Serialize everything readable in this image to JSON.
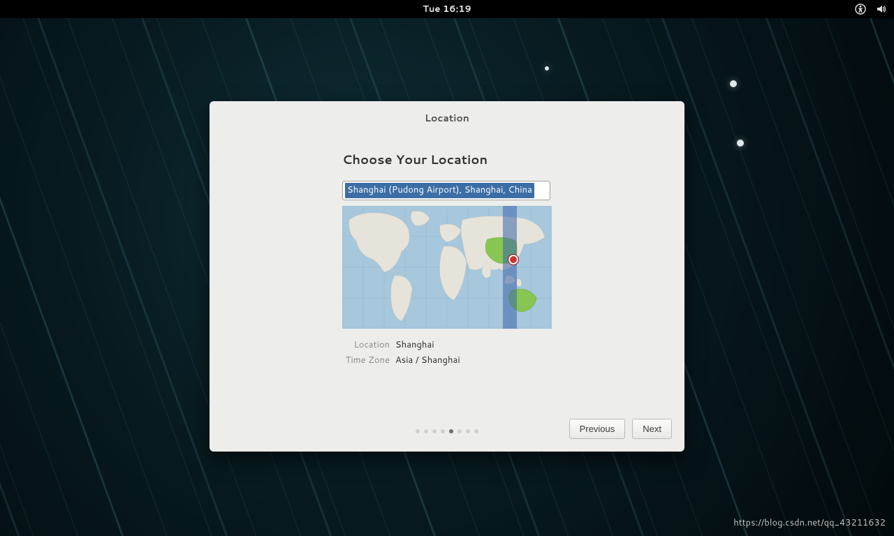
{
  "topbar": {
    "clock": "Tue 16:19",
    "icons": [
      "accessibility-icon",
      "volume-icon"
    ]
  },
  "dialog": {
    "title": "Location",
    "heading": "Choose Your Location",
    "search_value": "Shanghai (Pudong Airport), Shanghai, China",
    "details": {
      "location_label": "Location",
      "location_value": "Shanghai",
      "timezone_label": "Time Zone",
      "timezone_value": "Asia / Shanghai"
    },
    "buttons": {
      "previous": "Previous",
      "next": "Next"
    },
    "pager": {
      "total": 8,
      "current_index": 4
    },
    "map": {
      "highlighted_country": "China",
      "pin_label": "Shanghai"
    }
  },
  "watermark": "https://blog.csdn.net/qq_43211632"
}
